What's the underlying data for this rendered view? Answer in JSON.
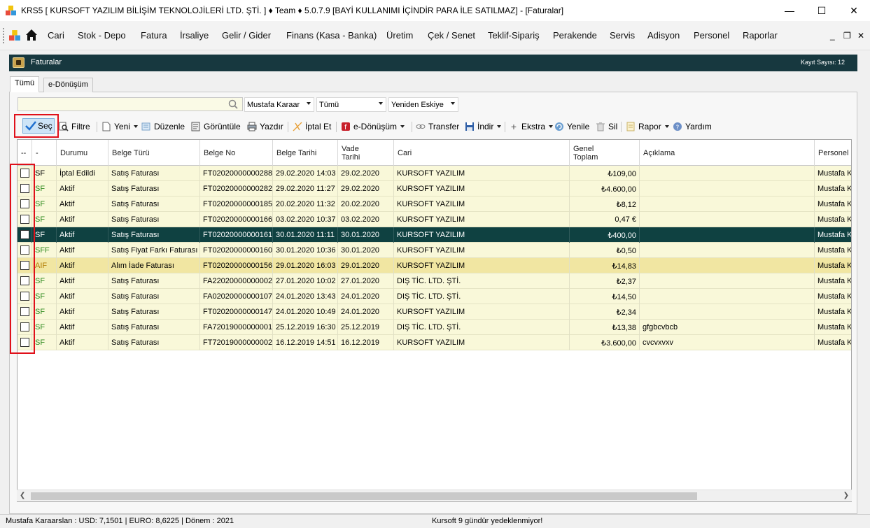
{
  "window": {
    "title": "KRS5 [ KURSOFT YAZILIM BİLİŞİM TEKNOLOJİLERİ LTD. ŞTİ. ] ♦ Team ♦ 5.0.7.9 [BAYİ KULLANIMI İÇİNDİR PARA İLE SATILMAZ] - [Faturalar]",
    "minimize": "—",
    "maximize": "☐",
    "close": "✕"
  },
  "menu": {
    "items": [
      "Cari",
      "Stok - Depo",
      "Fatura",
      "İrsaliye",
      "Gelir / Gider",
      "Finans (Kasa - Banka)",
      "Üretim",
      "Çek / Senet",
      "Teklif-Sipariş",
      "Perakende",
      "Servis",
      "Adisyon",
      "Personel",
      "Raporlar"
    ],
    "mdi_minimize": "_",
    "mdi_restore": "❐",
    "mdi_close": "✕"
  },
  "form": {
    "title": "Faturalar",
    "record_count": "Kayıt Sayısı: 12"
  },
  "tabs": {
    "all": "Tümü",
    "edonusum": "e-Dönüşüm"
  },
  "filters": {
    "search_value": "",
    "user": "Mustafa Karaar",
    "type": "Tümü",
    "sort": "Yeniden Eskiye"
  },
  "toolbar": {
    "sec": "Seç",
    "filtre": "Filtre",
    "yeni": "Yeni",
    "duzenle": "Düzenle",
    "goruntule": "Görüntüle",
    "yazdir": "Yazdır",
    "iptal": "İptal Et",
    "edonusum": "e-Dönüşüm",
    "transfer": "Transfer",
    "indir": "İndir",
    "ekstra": "Ekstra",
    "yenile": "Yenile",
    "sil": "Sil",
    "rapor": "Rapor",
    "yardim": "Yardım"
  },
  "grid": {
    "headers": {
      "check": "--",
      "type": "-",
      "durum": "Durumu",
      "belge_turu": "Belge Türü",
      "belge_no": "Belge No",
      "belge_tarihi": "Belge Tarihi",
      "vade_tarihi_1": "Vade",
      "vade_tarihi_2": "Tarihi",
      "cari": "Cari",
      "genel_toplam_1": "Genel",
      "genel_toplam_2": "Toplam",
      "aciklama": "Açıklama",
      "personel": "Personel"
    },
    "rows": [
      {
        "type": "SF",
        "durum": "İptal Edildi",
        "belge_turu": "Satış Faturası",
        "belge_no": "FT02020000000288",
        "belge_tarihi": "29.02.2020 14:03",
        "vade": "29.02.2020",
        "cari": "KURSOFT YAZILIM",
        "toplam": "₺109,00",
        "aciklama": "",
        "personel": "Mustafa K"
      },
      {
        "type": "SF",
        "durum": "Aktif",
        "belge_turu": "Satış Faturası",
        "belge_no": "FT02020000000282",
        "belge_tarihi": "29.02.2020 11:27",
        "vade": "29.02.2020",
        "cari": "KURSOFT YAZILIM",
        "toplam": "₺4.600,00",
        "aciklama": "",
        "personel": "Mustafa K"
      },
      {
        "type": "SF",
        "durum": "Aktif",
        "belge_turu": "Satış Faturası",
        "belge_no": "FT02020000000185",
        "belge_tarihi": "20.02.2020 11:32",
        "vade": "20.02.2020",
        "cari": "KURSOFT YAZILIM",
        "toplam": "₺8,12",
        "aciklama": "",
        "personel": "Mustafa K"
      },
      {
        "type": "SF",
        "durum": "Aktif",
        "belge_turu": "Satış Faturası",
        "belge_no": "FT02020000000166",
        "belge_tarihi": "03.02.2020 10:37",
        "vade": "03.02.2020",
        "cari": "KURSOFT YAZILIM",
        "toplam": "0,47 €",
        "aciklama": "",
        "personel": "Mustafa K"
      },
      {
        "type": "SF",
        "durum": "Aktif",
        "belge_turu": "Satış Faturası",
        "belge_no": "FT02020000000161",
        "belge_tarihi": "30.01.2020 11:11",
        "vade": "30.01.2020",
        "cari": "KURSOFT YAZILIM",
        "toplam": "₺400,00",
        "aciklama": "",
        "personel": "Mustafa K"
      },
      {
        "type": "SFF",
        "durum": "Aktif",
        "belge_turu": "Satış Fiyat Farkı Faturası",
        "belge_no": "FT02020000000160",
        "belge_tarihi": "30.01.2020 10:36",
        "vade": "30.01.2020",
        "cari": "KURSOFT YAZILIM",
        "toplam": "₺0,50",
        "aciklama": "",
        "personel": "Mustafa K"
      },
      {
        "type": "AIF",
        "durum": "Aktif",
        "belge_turu": "Alım İade Faturası",
        "belge_no": "FT02020000000156",
        "belge_tarihi": "29.01.2020 16:03",
        "vade": "29.01.2020",
        "cari": "KURSOFT YAZILIM",
        "toplam": "₺14,83",
        "aciklama": "",
        "personel": "Mustafa K"
      },
      {
        "type": "SF",
        "durum": "Aktif",
        "belge_turu": "Satış Faturası",
        "belge_no": "FA22020000000002",
        "belge_tarihi": "27.01.2020 10:02",
        "vade": "27.01.2020",
        "cari": "DIŞ TİC. LTD. ŞTİ.",
        "toplam": "₺2,37",
        "aciklama": "",
        "personel": "Mustafa K"
      },
      {
        "type": "SF",
        "durum": "Aktif",
        "belge_turu": "Satış Faturası",
        "belge_no": "FA02020000000107",
        "belge_tarihi": "24.01.2020 13:43",
        "vade": "24.01.2020",
        "cari": "DIŞ TİC. LTD. ŞTİ.",
        "toplam": "₺14,50",
        "aciklama": "",
        "personel": "Mustafa K"
      },
      {
        "type": "SF",
        "durum": "Aktif",
        "belge_turu": "Satış Faturası",
        "belge_no": "FT02020000000147",
        "belge_tarihi": "24.01.2020 10:49",
        "vade": "24.01.2020",
        "cari": "KURSOFT YAZILIM",
        "toplam": "₺2,34",
        "aciklama": "",
        "personel": "Mustafa K"
      },
      {
        "type": "SF",
        "durum": "Aktif",
        "belge_turu": "Satış Faturası",
        "belge_no": "FA72019000000001",
        "belge_tarihi": "25.12.2019 16:30",
        "vade": "25.12.2019",
        "cari": "DIŞ TİC. LTD. ŞTİ.",
        "toplam": "₺13,38",
        "aciklama": "gfgbcvbcb",
        "personel": "Mustafa K"
      },
      {
        "type": "SF",
        "durum": "Aktif",
        "belge_turu": "Satış Faturası",
        "belge_no": "FT72019000000002",
        "belge_tarihi": "16.12.2019 14:51",
        "vade": "16.12.2019",
        "cari": "KURSOFT YAZILIM",
        "toplam": "₺3.600,00",
        "aciklama": "cvcvxvxv",
        "personel": "Mustafa K"
      }
    ]
  },
  "status": {
    "left": "Mustafa Karaarslan :  USD: 7,1501 | EURO: 8,6225   | Dönem : 2021",
    "center": "Kursoft 9 gündür yedeklenmiyor!"
  },
  "colors": {
    "header_bg": "#17383f",
    "row_bg": "#f9f8d9",
    "selected_row_bg": "#0f4141",
    "highlight_row_bg": "#f1e6a2",
    "annotation_red": "#e0101a"
  }
}
